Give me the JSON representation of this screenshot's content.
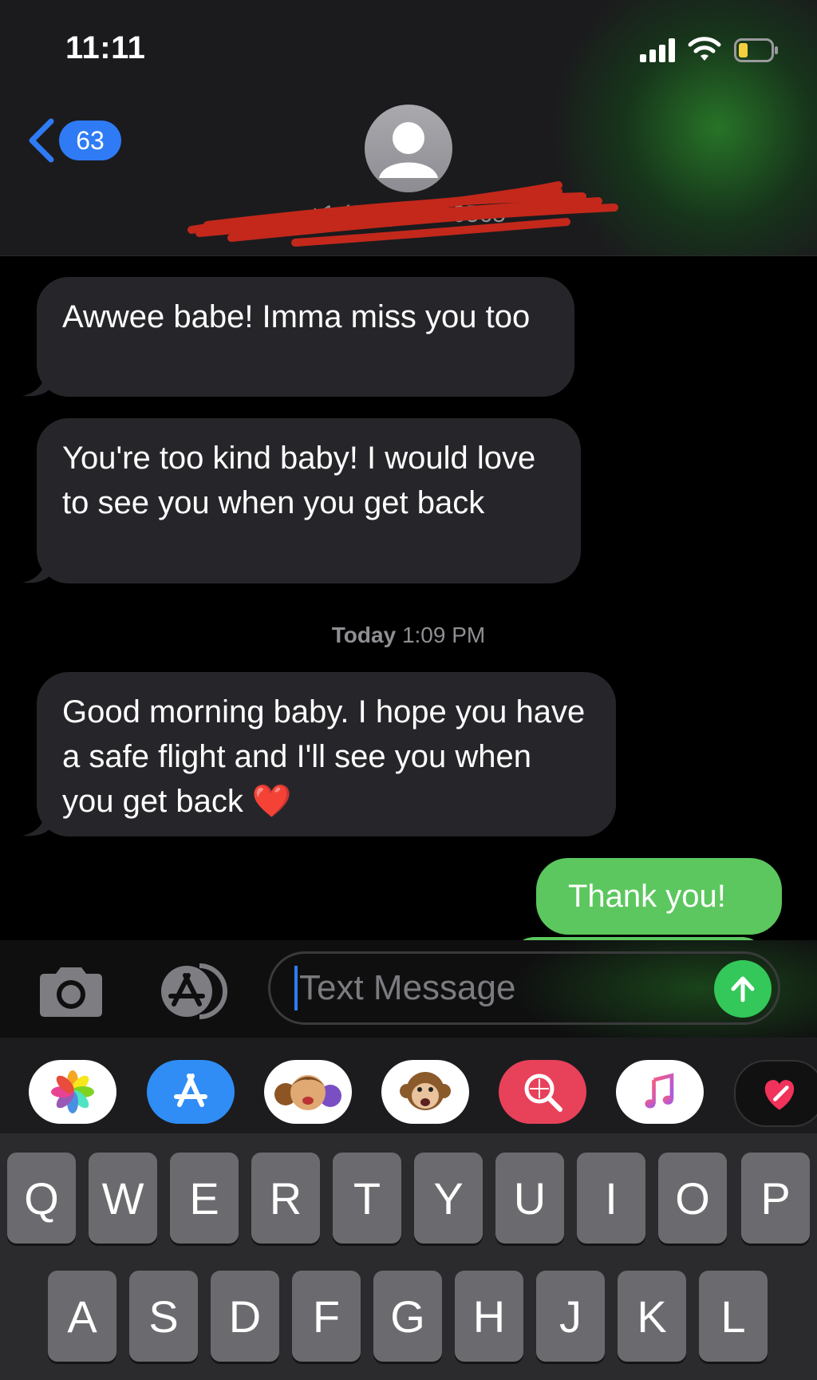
{
  "status_bar": {
    "time": "11:11"
  },
  "header": {
    "back_badge": "63",
    "contact": "+1 (905) 973-0565"
  },
  "messages": [
    {
      "direction": "incoming",
      "text": "Awwee babe! Imma miss you too"
    },
    {
      "direction": "incoming",
      "text": "You're too kind baby! I would love to see you when you get back"
    },
    {
      "direction": "incoming",
      "text": "Good morning baby. I hope you have a safe flight and I'll see you when you get back ❤️"
    },
    {
      "direction": "outgoing",
      "text": "Thank you!"
    }
  ],
  "timestamp": {
    "day": "Today",
    "time": "1:09 PM"
  },
  "composer": {
    "placeholder": "Text Message"
  },
  "app_strip": [
    "photos-app-icon",
    "app-store-icon",
    "memoji-icon",
    "animoji-monkey-icon",
    "search-images-icon",
    "music-icon",
    "digital-touch-heart-icon"
  ],
  "keyboard": {
    "row1": [
      "Q",
      "W",
      "E",
      "R",
      "T",
      "Y",
      "U",
      "I",
      "O",
      "P"
    ],
    "row2": [
      "A",
      "S",
      "D",
      "F",
      "G",
      "H",
      "J",
      "K",
      "L"
    ]
  },
  "colors": {
    "incoming_bubble": "#26262a",
    "outgoing_bubble": "#5cc75e",
    "accent_blue": "#2f7bf5",
    "send_green": "#34c759"
  }
}
